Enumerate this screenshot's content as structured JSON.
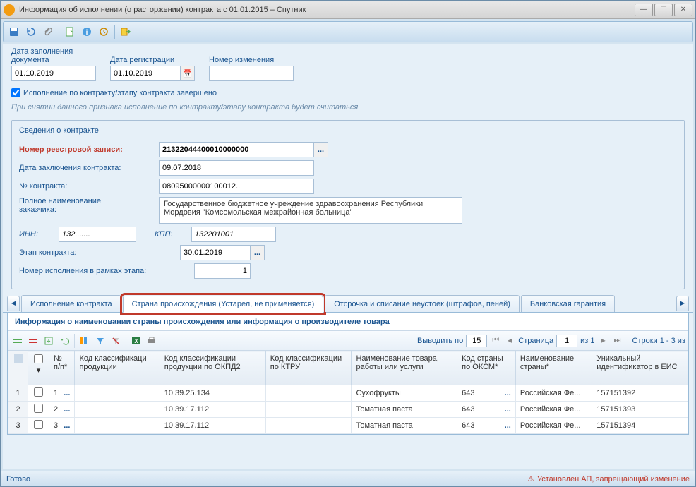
{
  "window": {
    "title": "Информация об исполнении (о расторжении) контракта с 01.01.2015 – Спутник"
  },
  "header": {
    "date_doc_label": "Дата заполнения\nдокумента",
    "date_doc": "01.10.2019",
    "date_reg_label": "Дата регистрации",
    "date_reg": "01.10.2019",
    "change_num_label": "Номер изменения",
    "change_num": "",
    "completed_label": "Исполнение по контракту/этапу контракта завершено",
    "hint": "При снятии данного признака исполнение по контракту/этапу контракта будет считаться"
  },
  "contract": {
    "legend": "Сведения о контракте",
    "reg_num_label": "Номер реестровой записи:",
    "reg_num": "21322044400010000000",
    "date_concl_label": "Дата заключения контракта:",
    "date_concl": "09.07.2018",
    "num_label": "№ контракта:",
    "num": "08095000000100012..",
    "customer_label": "Полное наименование\nзаказчика:",
    "customer": "Государственное бюджетное учреждение здравоохранения Республики Мордовия \"Комсомольская межрайонная больница\"",
    "inn_label": "ИНН:",
    "inn": "132.......",
    "kpp_label": "КПП:",
    "kpp": "132201001",
    "stage_label": "Этап контракта:",
    "stage": "30.01.2019",
    "exec_num_label": "Номер исполнения в рамках этапа:",
    "exec_num": "1"
  },
  "tabs": {
    "t1": "Исполнение контракта",
    "t2": "Страна происхождения (Устарел, не применяется)",
    "t3": "Отсрочка и списание неустоек (штрафов, пеней)",
    "t4": "Банковская гарантия"
  },
  "panel": {
    "title": "Информация о наименовании страны происхождения или информация о производителе товара",
    "show_per": "Выводить по",
    "per_page": "15",
    "page_label": "Страница",
    "page": "1",
    "page_of": "из 1",
    "rows_label": "Строки 1 - 3 из"
  },
  "columns": {
    "c1": "№ п/п*",
    "c2": "Код классификаци продукции",
    "c3": "Код классификации продукции по ОКПД2",
    "c4": "Код классификации по КТРУ",
    "c5": "Наименование товара, работы или услуги",
    "c6": "Код страны по ОКСМ*",
    "c7": "Наименование страны*",
    "c8": "Уникальный идентификатор в ЕИС"
  },
  "rows": [
    {
      "n": "1",
      "num": "1",
      "okpd2": "10.39.25.134",
      "name": "Сухофрукты",
      "country_code": "643",
      "country": "Российская Фе...",
      "uid": "157151392"
    },
    {
      "n": "2",
      "num": "2",
      "okpd2": "10.39.17.112",
      "name": "Томатная паста",
      "country_code": "643",
      "country": "Российская Фе...",
      "uid": "157151393"
    },
    {
      "n": "3",
      "num": "3",
      "okpd2": "10.39.17.112",
      "name": "Томатная паста",
      "country_code": "643",
      "country": "Российская Фе...",
      "uid": "157151394"
    }
  ],
  "status": {
    "ready": "Готово",
    "warn": "Установлен АП, запрещающий изменение"
  }
}
